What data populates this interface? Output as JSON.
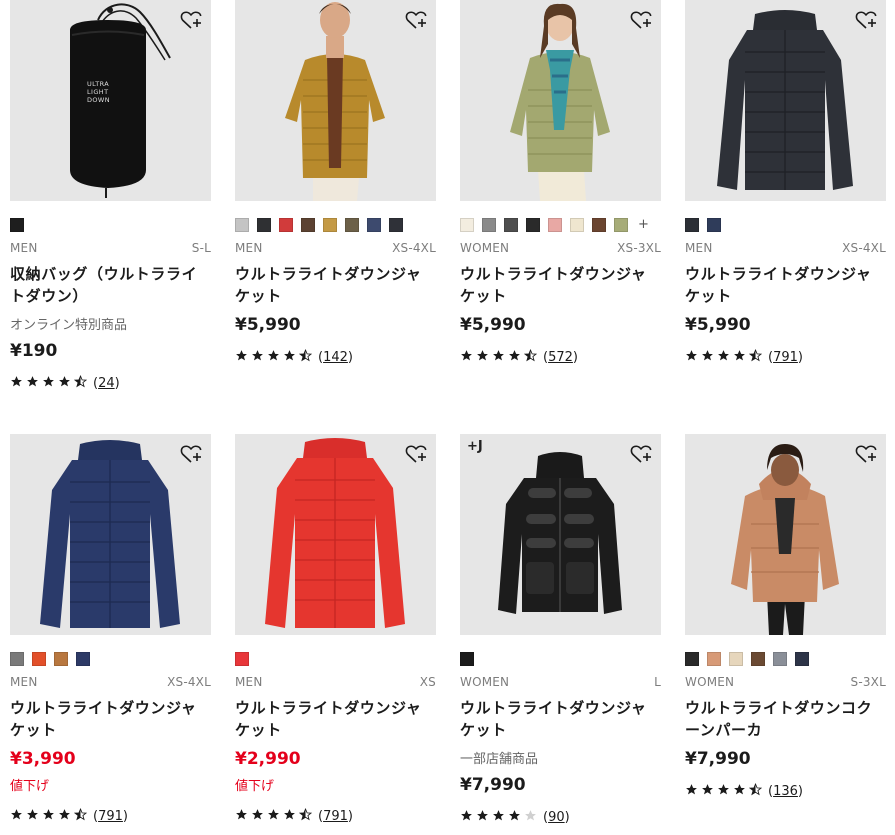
{
  "products": [
    {
      "gender": "MEN",
      "size": "S-L",
      "name": "収納バッグ（ウルトラライトダウン）",
      "note": "オンライン特別商品",
      "price": "¥190",
      "sale": false,
      "sale_label": "",
      "rating": 4.5,
      "reviews": "24",
      "swatches": [
        "#1e1e1e"
      ],
      "more": "",
      "badge": "",
      "image": "bag",
      "bag_text": "ULTRA LIGHT DOWN"
    },
    {
      "gender": "MEN",
      "size": "XS-4XL",
      "name": "ウルトラライトダウンジャケット",
      "note": "",
      "price": "¥5,990",
      "sale": false,
      "sale_label": "",
      "rating": 4.5,
      "reviews": "142",
      "swatches": [
        "#c4c4c4",
        "#2f3033",
        "#d13b3b",
        "#5c4232",
        "#c49a45",
        "#6c6048",
        "#3d4a6e",
        "#2f3138"
      ],
      "more": "",
      "badge": "",
      "image": "model-mustard"
    },
    {
      "gender": "WOMEN",
      "size": "XS-3XL",
      "name": "ウルトラライトダウンジャケット",
      "note": "",
      "price": "¥5,990",
      "sale": false,
      "sale_label": "",
      "rating": 4.5,
      "reviews": "572",
      "swatches": [
        "#f3ede0",
        "#8a8a8a",
        "#4e4e4e",
        "#2a2a2a",
        "#e8a8a4",
        "#efe6cf",
        "#6b4530",
        "#a7ac78"
      ],
      "more": "+",
      "badge": "",
      "image": "model-olive"
    },
    {
      "gender": "MEN",
      "size": "XS-4XL",
      "name": "ウルトラライトダウンジャケット",
      "note": "",
      "price": "¥5,990",
      "sale": false,
      "sale_label": "",
      "rating": 4.5,
      "reviews": "791",
      "swatches": [
        "#2c2f36",
        "#2f3c5a"
      ],
      "more": "",
      "badge": "",
      "image": "jacket-black"
    },
    {
      "gender": "MEN",
      "size": "XS-4XL",
      "name": "ウルトラライトダウンジャケット",
      "note": "",
      "price": "¥3,990",
      "sale": true,
      "sale_label": "値下げ",
      "rating": 4.5,
      "reviews": "791",
      "swatches": [
        "#7a7a7a",
        "#e2502a",
        "#b8773f",
        "#2d3a66"
      ],
      "more": "",
      "badge": "",
      "image": "jacket-navy"
    },
    {
      "gender": "MEN",
      "size": "XS",
      "name": "ウルトラライトダウンジャケット",
      "note": "",
      "price": "¥2,990",
      "sale": true,
      "sale_label": "値下げ",
      "rating": 4.5,
      "reviews": "791",
      "swatches": [
        "#e8363a"
      ],
      "more": "",
      "badge": "",
      "image": "jacket-red"
    },
    {
      "gender": "WOMEN",
      "size": "L",
      "name": "ウルトラライトダウンジャケット",
      "note": "一部店舗商品",
      "price": "¥7,990",
      "sale": false,
      "sale_label": "",
      "rating": 4,
      "reviews": "90",
      "swatches": [
        "#1b1b1b"
      ],
      "more": "",
      "badge": "+J",
      "image": "jacket-shiny"
    },
    {
      "gender": "WOMEN",
      "size": "S-3XL",
      "name": "ウルトラライトダウンコクーンパーカ",
      "note": "",
      "price": "¥7,990",
      "sale": false,
      "sale_label": "",
      "rating": 4.5,
      "reviews": "136",
      "swatches": [
        "#2a2a2a",
        "#d79a77",
        "#e6d6bc",
        "#6b4a33",
        "#8a8f98",
        "#2d3448"
      ],
      "more": "",
      "badge": "",
      "image": "model-parka"
    }
  ],
  "colors": {
    "sale_red": "#e4001b",
    "card_bg": "#e6e6e6",
    "text": "#1b1b1b",
    "muted": "#7d7d7d"
  },
  "icons": {
    "favorite": "heart-plus-icon",
    "star": "star-icon"
  }
}
